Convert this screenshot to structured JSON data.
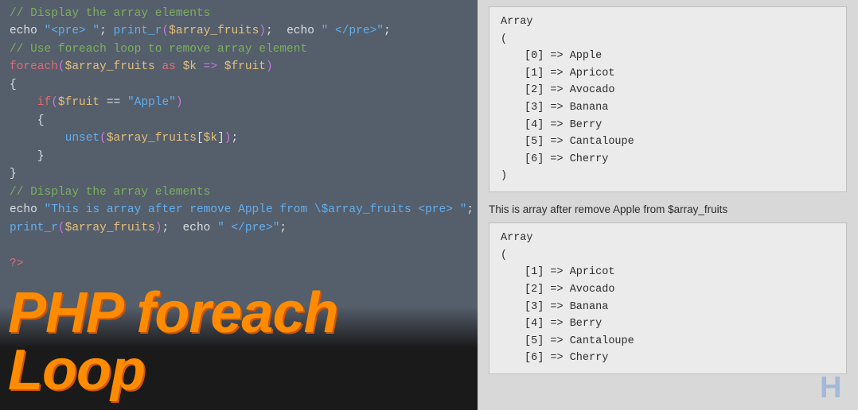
{
  "code": {
    "lines": [
      {
        "parts": [
          {
            "text": "// Display the array elements",
            "cls": "c-comment"
          }
        ]
      },
      {
        "parts": [
          {
            "text": "echo ",
            "cls": "c-white"
          },
          {
            "text": "\"<pre> \"",
            "cls": "c-string"
          },
          {
            "text": "; ",
            "cls": "c-white"
          },
          {
            "text": "print_r",
            "cls": "c-func"
          },
          {
            "text": "(",
            "cls": "c-paren"
          },
          {
            "text": "$array_fruits",
            "cls": "c-var"
          },
          {
            "text": ")",
            "cls": "c-paren"
          },
          {
            "text": ";  echo ",
            "cls": "c-white"
          },
          {
            "text": "\" </pre>\"",
            "cls": "c-string"
          },
          {
            "text": ";",
            "cls": "c-white"
          }
        ]
      },
      {
        "parts": [
          {
            "text": "// Use foreach loop to remove array element",
            "cls": "c-comment"
          }
        ]
      },
      {
        "parts": [
          {
            "text": "foreach",
            "cls": "c-keyword"
          },
          {
            "text": "(",
            "cls": "c-paren"
          },
          {
            "text": "$array_fruits",
            "cls": "c-var"
          },
          {
            "text": " as ",
            "cls": "c-keyword"
          },
          {
            "text": "$k",
            "cls": "c-var"
          },
          {
            "text": " => ",
            "cls": "c-arrow"
          },
          {
            "text": "$fruit",
            "cls": "c-var"
          },
          {
            "text": ")",
            "cls": "c-paren"
          }
        ]
      },
      {
        "parts": [
          {
            "text": "{",
            "cls": "c-white"
          }
        ]
      },
      {
        "parts": [
          {
            "text": "    if",
            "cls": "c-keyword"
          },
          {
            "text": "(",
            "cls": "c-paren"
          },
          {
            "text": "$fruit",
            "cls": "c-var"
          },
          {
            "text": " == ",
            "cls": "c-white"
          },
          {
            "text": "\"Apple\"",
            "cls": "c-string"
          },
          {
            "text": ")",
            "cls": "c-paren"
          }
        ]
      },
      {
        "parts": [
          {
            "text": "    {",
            "cls": "c-white"
          }
        ]
      },
      {
        "parts": [
          {
            "text": "        unset",
            "cls": "c-func"
          },
          {
            "text": "(",
            "cls": "c-paren"
          },
          {
            "text": "$array_fruits",
            "cls": "c-var"
          },
          {
            "text": "[",
            "cls": "c-white"
          },
          {
            "text": "$k",
            "cls": "c-var"
          },
          {
            "text": "]",
            "cls": "c-white"
          },
          {
            "text": ")",
            "cls": "c-paren"
          },
          {
            "text": ";",
            "cls": "c-white"
          }
        ]
      },
      {
        "parts": [
          {
            "text": "    }",
            "cls": "c-white"
          }
        ]
      },
      {
        "parts": [
          {
            "text": "}",
            "cls": "c-white"
          }
        ]
      },
      {
        "parts": [
          {
            "text": "// Display the array elements",
            "cls": "c-comment"
          }
        ]
      },
      {
        "parts": [
          {
            "text": "echo ",
            "cls": "c-white"
          },
          {
            "text": "\"This is array after remove Apple from \\$array_fruits <pre> \"",
            "cls": "c-string"
          },
          {
            "text": ";",
            "cls": "c-white"
          }
        ]
      },
      {
        "parts": [
          {
            "text": "print_r",
            "cls": "c-func"
          },
          {
            "text": "(",
            "cls": "c-paren"
          },
          {
            "text": "$array_fruits",
            "cls": "c-var"
          },
          {
            "text": ")",
            "cls": "c-paren"
          },
          {
            "text": ";  echo ",
            "cls": "c-white"
          },
          {
            "text": "\" </pre>\"",
            "cls": "c-string"
          },
          {
            "text": ";",
            "cls": "c-white"
          }
        ]
      },
      {
        "parts": [
          {
            "text": "",
            "cls": "c-white"
          }
        ]
      },
      {
        "parts": [
          {
            "text": "?>",
            "cls": "c-keyword"
          }
        ]
      }
    ]
  },
  "output": {
    "array1_header": "Array",
    "array1_open": "(",
    "array1_items": [
      "[0] => Apple",
      "[1] => Apricot",
      "[2] => Avocado",
      "[3] => Banana",
      "[4] => Berry",
      "[5] => Cantaloupe",
      "[6] => Cherry"
    ],
    "array1_close": ")",
    "message": "This is array after remove Apple from $array_fruits",
    "array2_header": "Array",
    "array2_open": "(",
    "array2_items": [
      "[1] => Apricot",
      "[2] => Avocado",
      "[3] => Banana",
      "[4] => Berry",
      "[5] => Cantaloupe",
      "[6] => Cherry"
    ]
  },
  "title": "PHP foreach Loop"
}
